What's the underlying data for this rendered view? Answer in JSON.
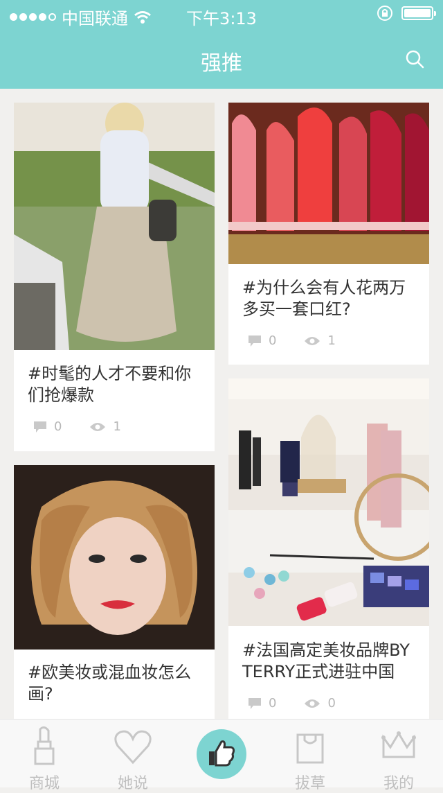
{
  "status_bar": {
    "carrier": "中国联通",
    "time": "下午3:13"
  },
  "header": {
    "title": "强推"
  },
  "feed": {
    "cards": [
      {
        "text": "#时髦的人才不要和你们抢爆款",
        "comments": "0",
        "views": "1"
      },
      {
        "text": "#为什么会有人花两万多买一套口红?",
        "comments": "0",
        "views": "1"
      },
      {
        "text": "#欧美妆或混血妆怎么画?"
      },
      {
        "text": "#法国高定美妆品牌BY TERRY正式进驻中国",
        "comments": "0",
        "views": "0"
      }
    ]
  },
  "tabbar": {
    "items": [
      {
        "label": "商城",
        "icon": "lipstick-icon"
      },
      {
        "label": "她说",
        "icon": "heart-icon"
      },
      {
        "label": "",
        "icon": "thumbs-up-icon"
      },
      {
        "label": "拔草",
        "icon": "shopping-bag-icon"
      },
      {
        "label": "我的",
        "icon": "crown-icon"
      }
    ]
  },
  "colors": {
    "accent": "#7dd4d1",
    "background": "#f1f0ee",
    "text": "#333333",
    "muted": "#b7b7b7"
  }
}
